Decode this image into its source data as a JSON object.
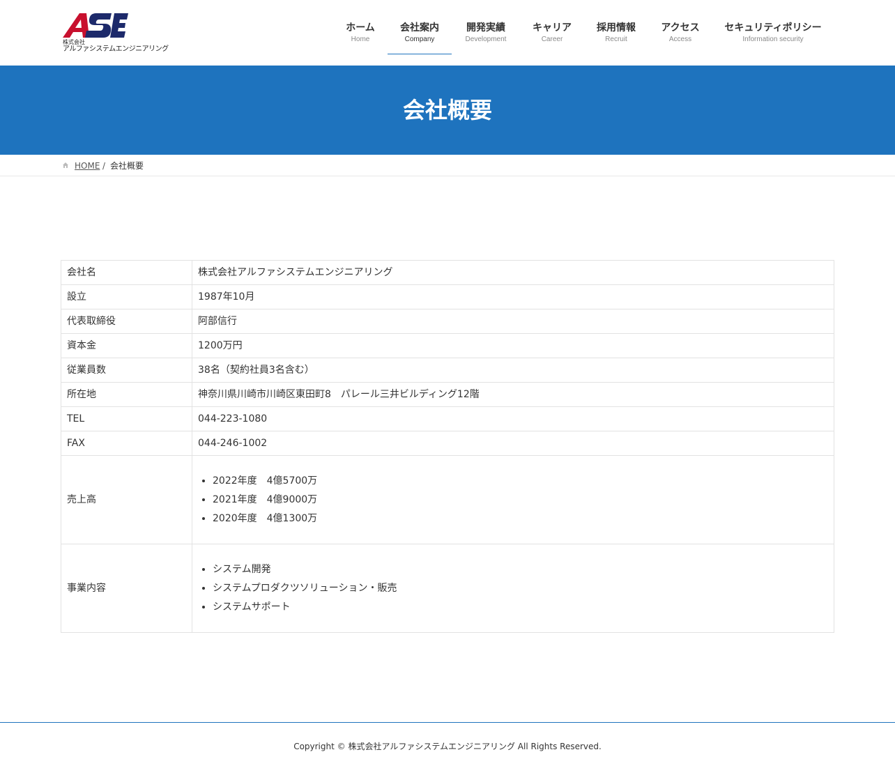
{
  "brand": {
    "logo_text": "ASE",
    "logo_sub1": "株式会社",
    "logo_sub2": "アルファシステムエンジニアリング",
    "colors": {
      "logo_red": "#c8102e",
      "logo_navy": "#1d2a6b",
      "accent": "#1e73be"
    }
  },
  "nav": [
    {
      "label": "ホーム",
      "sub": "Home",
      "active": false
    },
    {
      "label": "会社案内",
      "sub": "Company",
      "active": true
    },
    {
      "label": "開発実績",
      "sub": "Development",
      "active": false
    },
    {
      "label": "キャリア",
      "sub": "Career",
      "active": false
    },
    {
      "label": "採用情報",
      "sub": "Recruit",
      "active": false
    },
    {
      "label": "アクセス",
      "sub": "Access",
      "active": false
    },
    {
      "label": "セキュリティポリシー",
      "sub": "Information security",
      "active": false
    }
  ],
  "page_title": "会社概要",
  "breadcrumb": {
    "home_icon": "home-icon",
    "home": "HOME",
    "separator": "/",
    "current": "会社概要"
  },
  "company": {
    "rows": [
      {
        "label": "会社名",
        "value": "株式会社アルファシステムエンジニアリング"
      },
      {
        "label": "設立",
        "value": "1987年10月"
      },
      {
        "label": "代表取締役",
        "value": "阿部信行"
      },
      {
        "label": "資本金",
        "value": "1200万円"
      },
      {
        "label": "従業員数",
        "value": "38名（契約社員3名含む）"
      },
      {
        "label": "所在地",
        "value": "神奈川県川崎市川崎区東田町8　パレール三井ビルディング12階"
      },
      {
        "label": "TEL",
        "value": "044-223-1080"
      },
      {
        "label": "FAX",
        "value": "044-246-1002"
      }
    ],
    "sales": {
      "label": "売上高",
      "items": [
        "2022年度　4億5700万",
        "2021年度　4億9000万",
        "2020年度　4億1300万"
      ]
    },
    "business": {
      "label": "事業内容",
      "items": [
        "システム開発",
        "システムプロダクツソリューション・販売",
        "システムサポート"
      ]
    }
  },
  "footer": {
    "copyright": "Copyright © 株式会社アルファシステムエンジニアリング All Rights Reserved."
  }
}
